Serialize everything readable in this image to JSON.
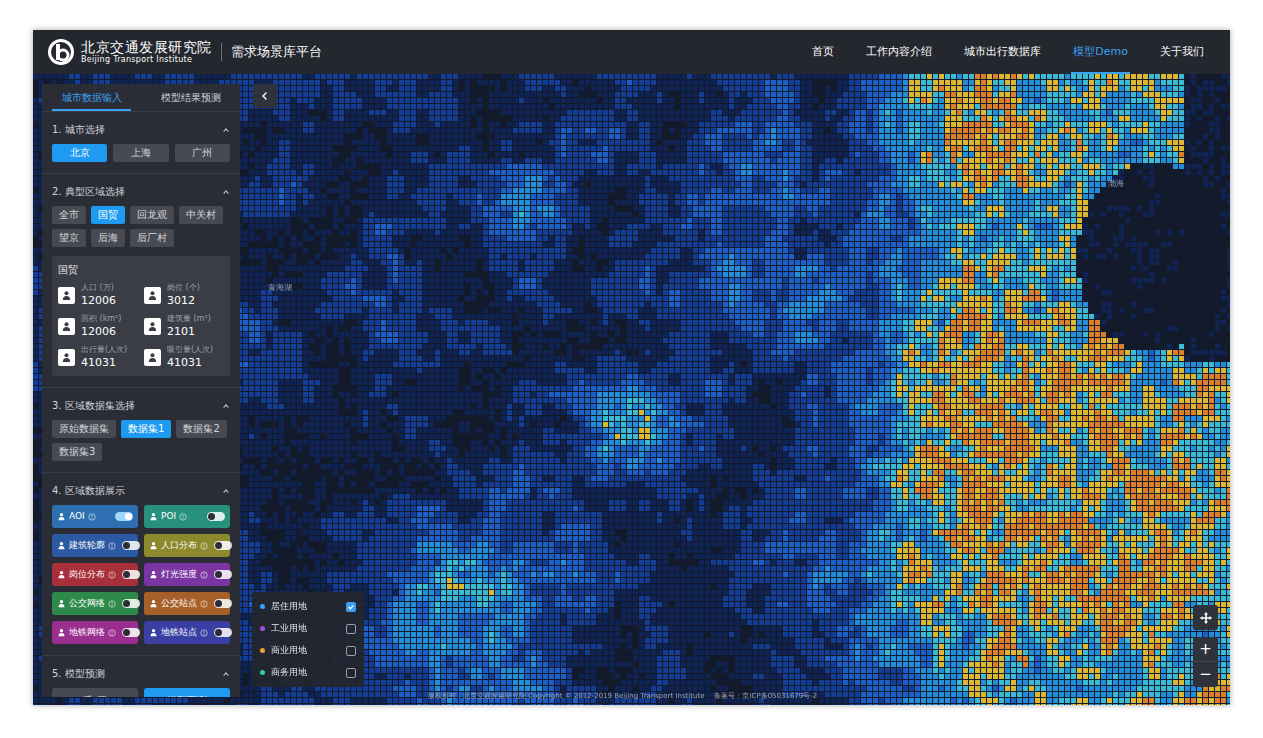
{
  "header": {
    "org_name": "北京交通发展研究院",
    "org_name_en": "Beijing Transport Institute",
    "platform": "需求场景库平台"
  },
  "nav": [
    {
      "label": "首页",
      "selected": false
    },
    {
      "label": "工作内容介绍",
      "selected": false
    },
    {
      "label": "城市出行数据库",
      "selected": false
    },
    {
      "label": "模型Demo",
      "selected": true
    },
    {
      "label": "关于我们",
      "selected": false
    }
  ],
  "panel": {
    "tabs": [
      {
        "label": "城市数据输入",
        "selected": true
      },
      {
        "label": "模型结果预测",
        "selected": false
      }
    ],
    "sections": [
      {
        "title": "1. 城市选择",
        "expanded": true
      },
      {
        "title": "2. 典型区域选择",
        "expanded": true
      },
      {
        "title": "3. 区域数据集选择",
        "expanded": true
      },
      {
        "title": "4. 区域数据展示",
        "expanded": true
      },
      {
        "title": "5. 模型预测",
        "expanded": true
      }
    ],
    "cities": [
      {
        "label": "北京",
        "selected": true
      },
      {
        "label": "上海",
        "selected": false
      },
      {
        "label": "广州",
        "selected": false
      }
    ],
    "regions": [
      {
        "label": "全市",
        "selected": false
      },
      {
        "label": "国贸",
        "selected": true
      },
      {
        "label": "回龙观",
        "selected": false
      },
      {
        "label": "中关村",
        "selected": false
      },
      {
        "label": "望京",
        "selected": false
      },
      {
        "label": "后海",
        "selected": false
      },
      {
        "label": "后厂村",
        "selected": false
      }
    ],
    "region_card": {
      "title": "国贸",
      "stats": [
        {
          "label": "人口 (万)",
          "value": "12006"
        },
        {
          "label": "岗位 (个)",
          "value": "3012"
        },
        {
          "label": "面积 (km²)",
          "value": "12006"
        },
        {
          "label": "建筑量 (m²)",
          "value": "2101"
        },
        {
          "label": "出行量(人次)",
          "value": "41031"
        },
        {
          "label": "吸引量(人次)",
          "value": "41031"
        }
      ]
    },
    "datasets": [
      {
        "label": "原始数据集",
        "selected": false
      },
      {
        "label": "数据集1",
        "selected": true
      },
      {
        "label": "数据集2",
        "selected": false
      },
      {
        "label": "数据集3",
        "selected": false
      }
    ],
    "layers": [
      {
        "label": "AOI",
        "on": true,
        "color": "#2d6fb0"
      },
      {
        "label": "POI",
        "on": false,
        "color": "#27917e"
      },
      {
        "label": "建筑轮廓",
        "on": false,
        "color": "#2b5aa3"
      },
      {
        "label": "人口分布",
        "on": false,
        "color": "#8c8a2c"
      },
      {
        "label": "岗位分布",
        "on": false,
        "color": "#a8303a"
      },
      {
        "label": "灯光强度",
        "on": false,
        "color": "#7a35a3"
      },
      {
        "label": "公交网络",
        "on": false,
        "color": "#2e8a4a"
      },
      {
        "label": "公交站点",
        "on": false,
        "color": "#a8602a"
      },
      {
        "label": "地铁网络",
        "on": false,
        "color": "#9a2f8f"
      },
      {
        "label": "地铁站点",
        "on": false,
        "color": "#3a3fa3"
      }
    ],
    "actions": [
      {
        "label": "重 置",
        "kind": "secondary"
      },
      {
        "label": "模型预测",
        "kind": "primary"
      }
    ]
  },
  "legend": [
    {
      "label": "居住用地",
      "color": "#3aa0ff",
      "checked": true
    },
    {
      "label": "工业用地",
      "color": "#a050e0",
      "checked": false
    },
    {
      "label": "商业用地",
      "color": "#f0a030",
      "checked": false
    },
    {
      "label": "商务用地",
      "color": "#30d0a0",
      "checked": false
    }
  ],
  "map_labels": [
    {
      "text": "渤海"
    },
    {
      "text": "青海湖"
    }
  ],
  "map_controls": {
    "zoom_in": "+",
    "zoom_out": "−"
  },
  "footer": {
    "copyright": "版权所有：北京交通发展研究院 Copyright © 2012-2019 Beijing Transport Institute",
    "icp": "备案号：京ICP备05031679号-2"
  }
}
